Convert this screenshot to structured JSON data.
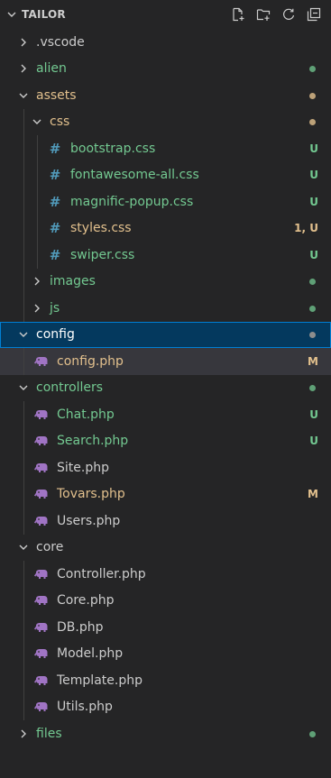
{
  "header": {
    "title": "TAILOR"
  },
  "colors": {
    "green": "#73c991",
    "yellow": "#e2c08d",
    "default": "#cccccc",
    "folder_dot": "#8d8d8d"
  },
  "tree": [
    {
      "name": ".vscode",
      "type": "folder",
      "depth": 0,
      "expanded": false,
      "color": "white",
      "status": ""
    },
    {
      "name": "alien",
      "type": "folder",
      "depth": 0,
      "expanded": false,
      "color": "green",
      "status": "dot-green"
    },
    {
      "name": "assets",
      "type": "folder",
      "depth": 0,
      "expanded": true,
      "color": "yellow",
      "status": "dot-yellow"
    },
    {
      "name": "css",
      "type": "folder",
      "depth": 1,
      "expanded": true,
      "color": "yellow",
      "status": "dot-yellow"
    },
    {
      "name": "bootstrap.css",
      "type": "css",
      "depth": 2,
      "color": "green",
      "status": "U"
    },
    {
      "name": "fontawesome-all.css",
      "type": "css",
      "depth": 2,
      "color": "green",
      "status": "U"
    },
    {
      "name": "magnific-popup.css",
      "type": "css",
      "depth": 2,
      "color": "green",
      "status": "U"
    },
    {
      "name": "styles.css",
      "type": "css",
      "depth": 2,
      "color": "yellow",
      "status": "1, U"
    },
    {
      "name": "swiper.css",
      "type": "css",
      "depth": 2,
      "color": "green",
      "status": "U"
    },
    {
      "name": "images",
      "type": "folder",
      "depth": 1,
      "expanded": false,
      "color": "green",
      "status": "dot-green"
    },
    {
      "name": "js",
      "type": "folder",
      "depth": 1,
      "expanded": false,
      "color": "green",
      "status": "dot-green"
    },
    {
      "name": "config",
      "type": "folder",
      "depth": 0,
      "expanded": true,
      "color": "sel",
      "status": "dot-grey",
      "selected": true
    },
    {
      "name": "config.php",
      "type": "php",
      "depth": 1,
      "color": "yellow",
      "status": "M",
      "active": true
    },
    {
      "name": "controllers",
      "type": "folder",
      "depth": 0,
      "expanded": true,
      "color": "green",
      "status": "dot-green"
    },
    {
      "name": "Chat.php",
      "type": "php",
      "depth": 1,
      "color": "green",
      "status": "U"
    },
    {
      "name": "Search.php",
      "type": "php",
      "depth": 1,
      "color": "green",
      "status": "U"
    },
    {
      "name": "Site.php",
      "type": "php",
      "depth": 1,
      "color": "white",
      "status": ""
    },
    {
      "name": "Tovars.php",
      "type": "php",
      "depth": 1,
      "color": "yellow",
      "status": "M"
    },
    {
      "name": "Users.php",
      "type": "php",
      "depth": 1,
      "color": "white",
      "status": ""
    },
    {
      "name": "core",
      "type": "folder",
      "depth": 0,
      "expanded": true,
      "color": "white",
      "status": ""
    },
    {
      "name": "Controller.php",
      "type": "php",
      "depth": 1,
      "color": "white",
      "status": ""
    },
    {
      "name": "Core.php",
      "type": "php",
      "depth": 1,
      "color": "white",
      "status": ""
    },
    {
      "name": "DB.php",
      "type": "php",
      "depth": 1,
      "color": "white",
      "status": ""
    },
    {
      "name": "Model.php",
      "type": "php",
      "depth": 1,
      "color": "white",
      "status": ""
    },
    {
      "name": "Template.php",
      "type": "php",
      "depth": 1,
      "color": "white",
      "status": ""
    },
    {
      "name": "Utils.php",
      "type": "php",
      "depth": 1,
      "color": "white",
      "status": ""
    },
    {
      "name": "files",
      "type": "folder",
      "depth": 0,
      "expanded": false,
      "color": "green",
      "status": "dot-green"
    }
  ]
}
